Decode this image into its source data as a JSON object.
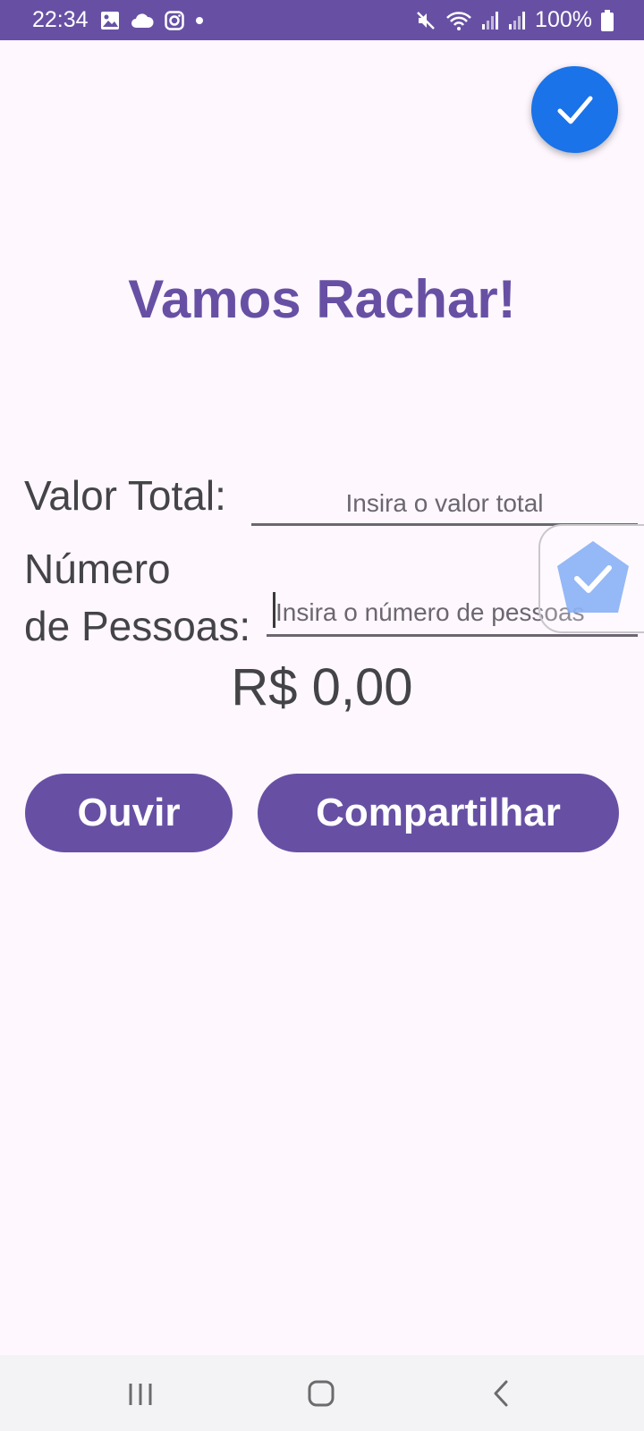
{
  "status_bar": {
    "time": "22:34",
    "battery": "100%",
    "left_icons": [
      "image-icon",
      "cloud-icon",
      "instagram-icon",
      "dot-icon"
    ],
    "right_icons": [
      "mute-icon",
      "wifi-icon",
      "signal-icon",
      "signal-icon",
      "battery-icon"
    ]
  },
  "app": {
    "title": "Vamos Rachar!",
    "valor_label": "Valor Total:",
    "valor_placeholder": "Insira o valor total",
    "numero_label_line1": "Número",
    "numero_label_line2": "de Pessoas:",
    "numero_placeholder": "Insira o número de pessoas",
    "result": "R$ 0,00",
    "ouvir_label": "Ouvir",
    "share_label": "Compartilhar"
  },
  "colors": {
    "accent": "#6750a4",
    "fab": "#1a73e8",
    "background": "#fef7fe",
    "text": "#444448"
  }
}
